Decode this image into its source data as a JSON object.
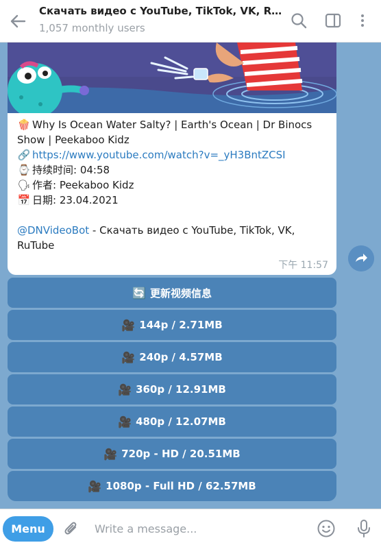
{
  "header": {
    "title": "Скачать видео с YouTube, TikTok, VK, RuTu…",
    "subtitle": "1,057 monthly users"
  },
  "message": {
    "line1_emoji": "🍿",
    "line1": "Why Is Ocean Water Salty? | Earth's Ocean | Dr Binocs",
    "line2": "Show | Peekaboo Kidz",
    "link_emoji": "🔗",
    "link": "https://www.youtube.com/watch?v=_yH3BntZCSI",
    "duration_emoji": "⌚",
    "duration": "持续时间: 04:58",
    "author_emoji": "🗣",
    "author": "作者: Peekaboo Kidz",
    "date_emoji": "📅",
    "date": "日期: 23.04.2021",
    "bot_mention": "@DNVideoBot",
    "bot_text": " - Скачать видео с YouTube, TikTok, VK,",
    "bot_text2": "RuTube",
    "time": "下午 11:57"
  },
  "keyboard": {
    "refresh_emoji": "🔄",
    "refresh": "更新视频信息",
    "cam_emoji": "🎥",
    "buttons": [
      "144p / 2.71MB",
      "240p / 4.57MB",
      "360p / 12.91MB",
      "480p / 12.07MB",
      "720p - HD / 20.51MB",
      "1080p - Full HD / 62.57MB"
    ]
  },
  "composer": {
    "menu_label": "Menu",
    "placeholder": "Write a message..."
  }
}
